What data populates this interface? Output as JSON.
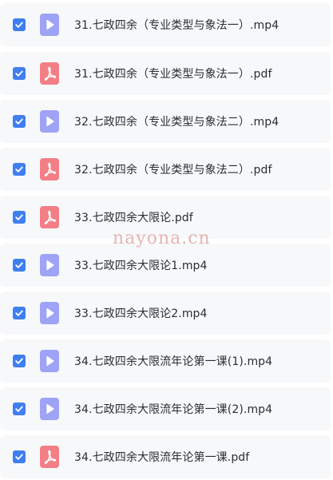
{
  "files": [
    {
      "name": "31.七政四余（专业类型与象法一）.mp4",
      "type": "video",
      "icon": "video-file-icon",
      "checked": true
    },
    {
      "name": "31.七政四余（专业类型与象法一）.pdf",
      "type": "pdf",
      "icon": "pdf-file-icon",
      "checked": true
    },
    {
      "name": "32.七政四余（专业类型与象法二）.mp4",
      "type": "video",
      "icon": "video-file-icon",
      "checked": true
    },
    {
      "name": "32.七政四余（专业类型与象法二）.pdf",
      "type": "pdf",
      "icon": "pdf-file-icon",
      "checked": true
    },
    {
      "name": "33.七政四余大限论.pdf",
      "type": "pdf",
      "icon": "pdf-file-icon",
      "checked": true
    },
    {
      "name": "33.七政四余大限论1.mp4",
      "type": "video",
      "icon": "video-file-icon",
      "checked": true
    },
    {
      "name": "33.七政四余大限论2.mp4",
      "type": "video",
      "icon": "video-file-icon",
      "checked": true
    },
    {
      "name": "34.七政四余大限流年论第一课(1).mp4",
      "type": "video",
      "icon": "video-file-icon",
      "checked": true
    },
    {
      "name": "34.七政四余大限流年论第一课(2).mp4",
      "type": "video",
      "icon": "video-file-icon",
      "checked": true
    },
    {
      "name": "34.七政四余大限流年论第一课.pdf",
      "type": "pdf",
      "icon": "pdf-file-icon",
      "checked": true
    }
  ],
  "watermark": "nayona.cn",
  "colors": {
    "checkbox": "#3f7ff0",
    "video_icon": "#9ea3f5",
    "pdf_icon": "#f37f86",
    "row_background": "#f7f8fa",
    "text": "#2a2d33"
  }
}
